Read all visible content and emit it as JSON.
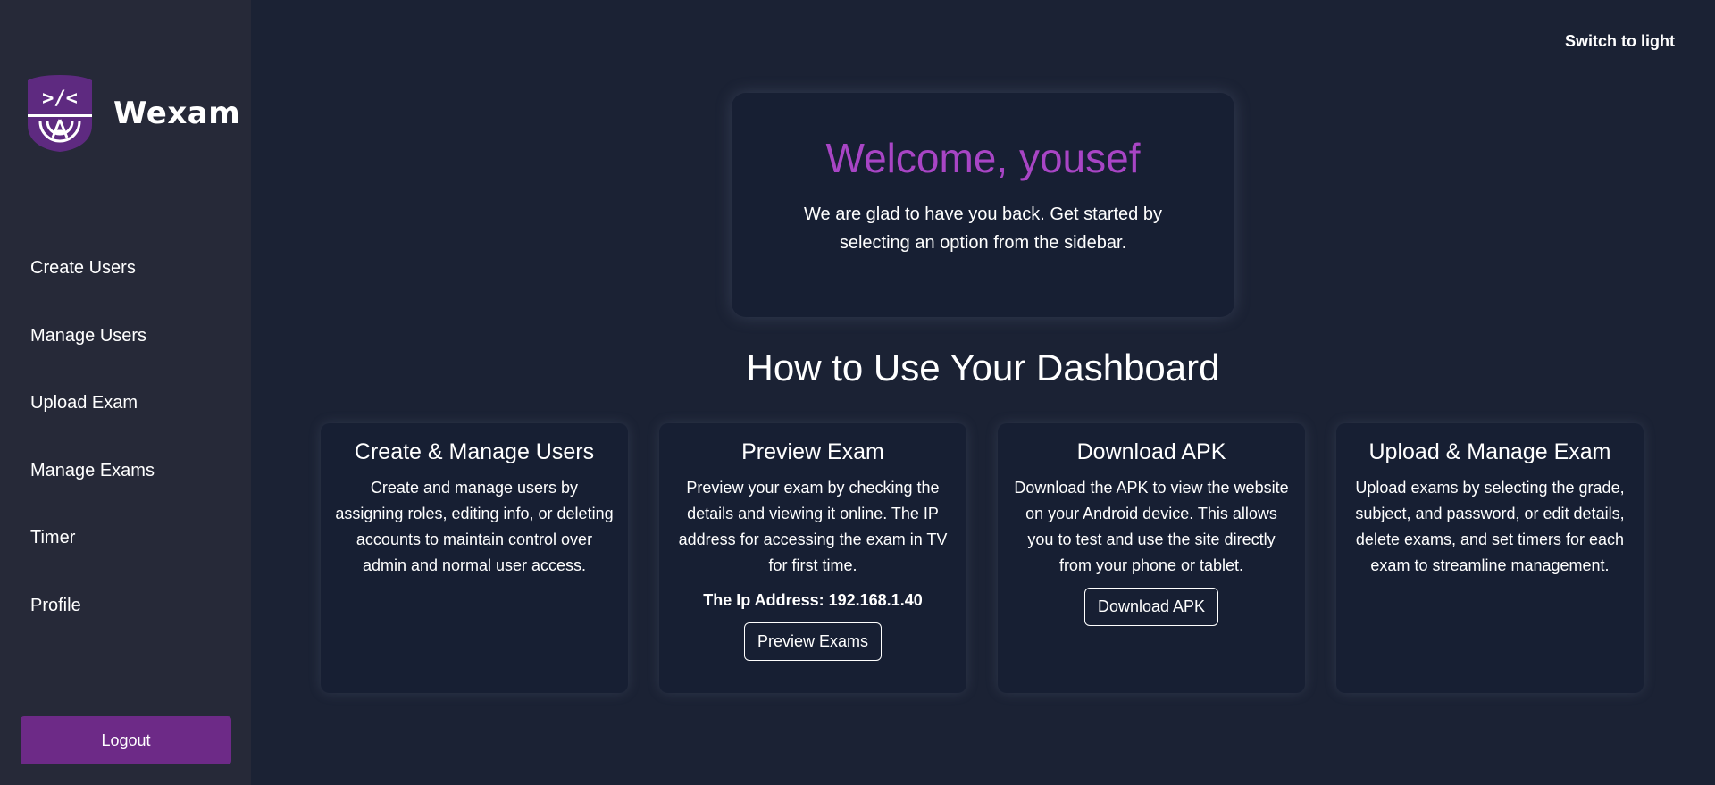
{
  "brand": {
    "name": "Wexam",
    "logo_glyph": ">/<"
  },
  "sidebar": {
    "items": [
      {
        "label": "Create Users"
      },
      {
        "label": "Manage Users"
      },
      {
        "label": "Upload Exam"
      },
      {
        "label": "Manage Exams"
      },
      {
        "label": "Timer"
      },
      {
        "label": "Profile"
      }
    ],
    "logout_label": "Logout"
  },
  "header": {
    "theme_toggle_label": "Switch to light"
  },
  "welcome": {
    "title": "Welcome, yousef",
    "text": "We are glad to have you back. Get started by selecting an option from the sidebar."
  },
  "dashboard": {
    "heading": "How to Use Your Dashboard",
    "cards": [
      {
        "title": "Create & Manage Users",
        "text": "Create and manage users by assigning roles, editing info, or deleting accounts to maintain control over admin and normal user access."
      },
      {
        "title": "Preview Exam",
        "text": "Preview your exam by checking the details and viewing it online. The IP address for accessing the exam in TV for first time.",
        "ip_text": "The Ip Address: 192.168.1.40",
        "button_label": "Preview Exams"
      },
      {
        "title": "Download APK",
        "text": "Download the APK to view the website on your Android device. This allows you to test and use the site directly from your phone or tablet.",
        "button_label": "Download APK"
      },
      {
        "title": "Upload & Manage Exam",
        "text": "Upload exams by selecting the grade, subject, and password, or edit details, delete exams, and set timers for each exam to streamline management."
      }
    ]
  },
  "colors": {
    "background": "#1b2234",
    "sidebar": "#262938",
    "card": "#171f33",
    "accent": "#a845c5",
    "logout": "#6d2a87"
  }
}
